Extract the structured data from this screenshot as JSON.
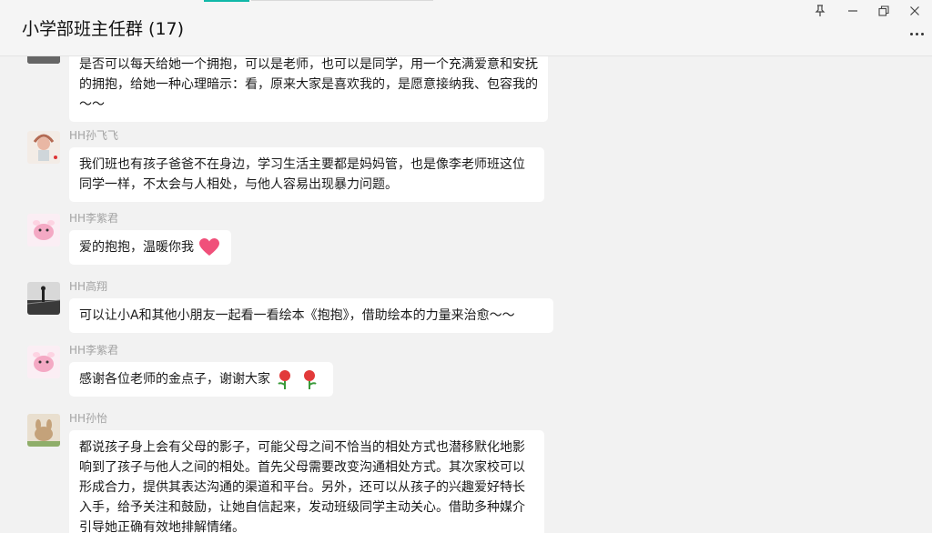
{
  "header": {
    "chat_title": "小学部班主任群 (17)",
    "pin_icon": "pin-icon",
    "minimize_label": "–",
    "restore_label": "⧉",
    "close_label": "✕"
  },
  "messages": [
    {
      "sender": "",
      "text": "是否可以每天给她一个拥抱，可以是老师，也可以是同学，用一个充满爱意和安抚的拥抱，给她一种心理暗示：看，原来大家是喜欢我的，是愿意接纳我、包容我的～～"
    },
    {
      "sender": "HH孙飞飞",
      "text": "我们班也有孩子爸爸不在身边，学习生活主要都是妈妈管，也是像李老师班这位同学一样，不太会与人相处，与他人容易出现暴力问题。"
    },
    {
      "sender": "HH李紫君",
      "text": "爱的抱抱，温暖你我"
    },
    {
      "sender": "HH高翔",
      "text": "可以让小A和其他小朋友一起看一看绘本《抱抱》，借助绘本的力量来治愈～～"
    },
    {
      "sender": "HH李紫君",
      "text": "感谢各位老师的金点子，谢谢大家"
    },
    {
      "sender": "HH孙怡",
      "text": "都说孩子身上会有父母的影子，可能父母之间不恰当的相处方式也潜移默化地影响到了孩子与他人之间的相处。首先父母需要改变沟通相处方式。其次家校可以形成合力，提供其表达沟通的渠道和平台。另外，还可以从孩子的兴趣爱好特长入手，给予关注和鼓励，让她自信起来，发动班级同学主动关心。借助多种媒介引导她正确有效地排解情绪。"
    }
  ]
}
